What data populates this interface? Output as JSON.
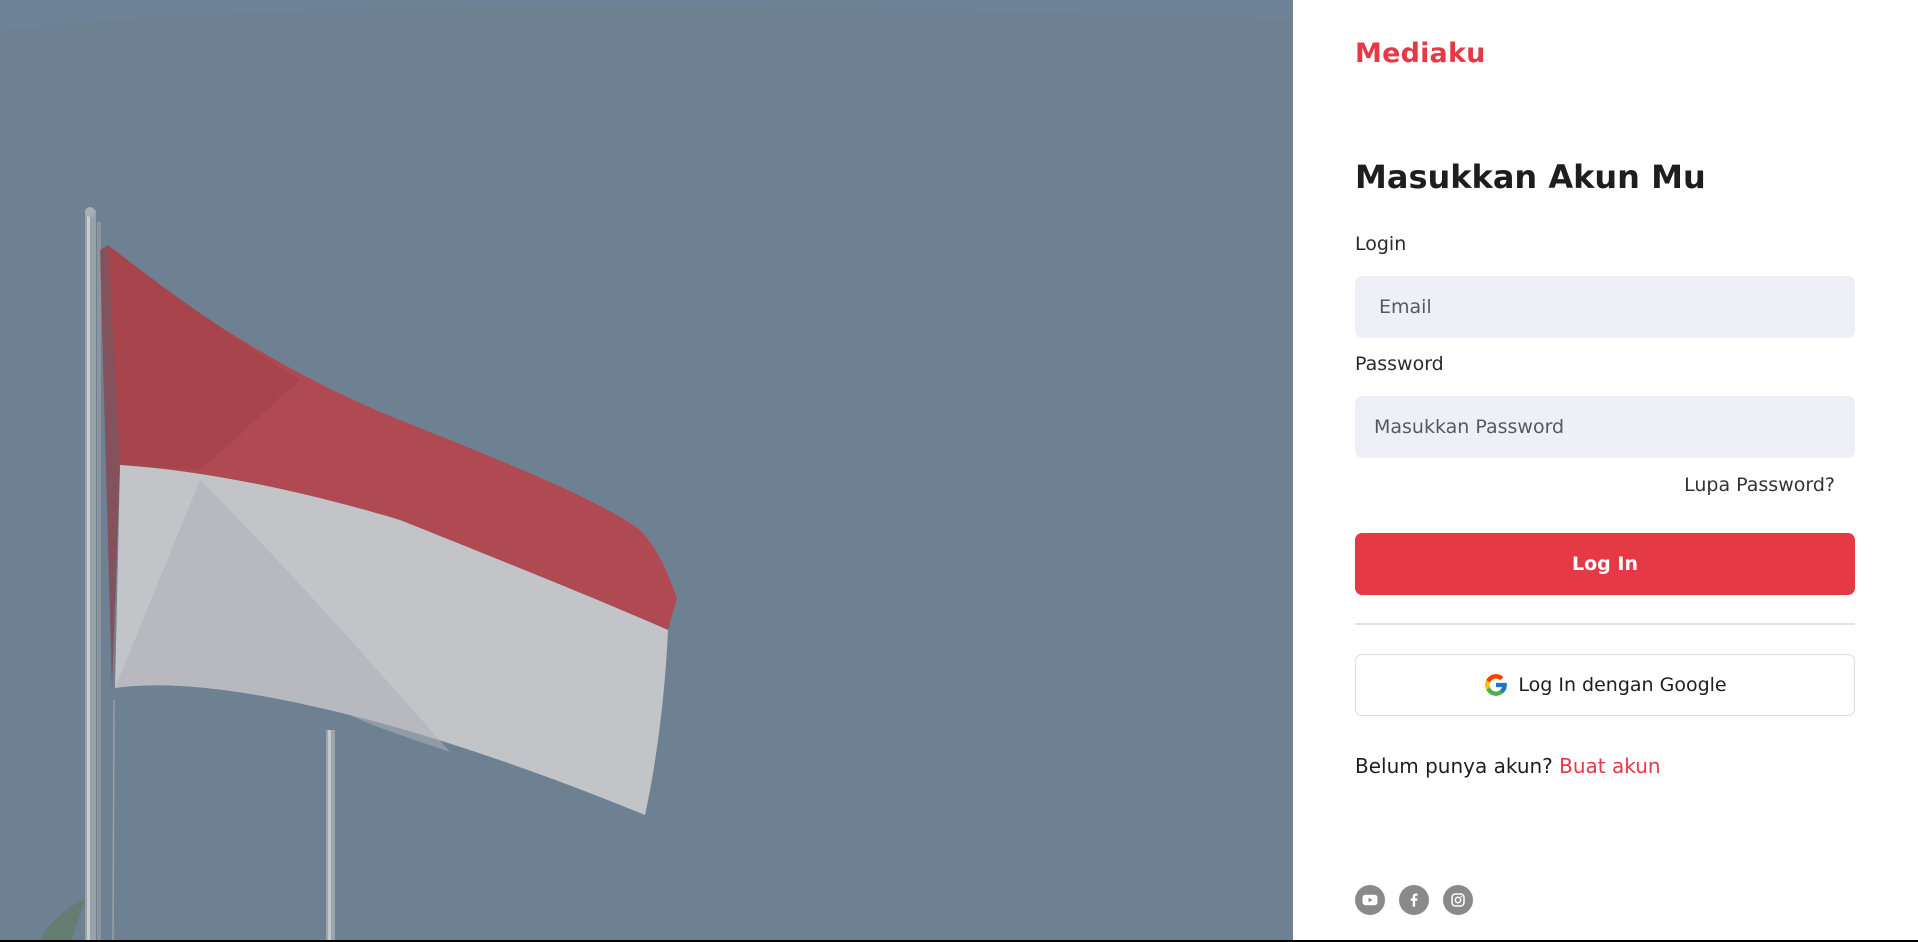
{
  "brand": {
    "name": "Mediaku"
  },
  "hero": {
    "image": "indonesian-flag-on-pole",
    "colors": {
      "sky": "#6d8193",
      "flag_red": "#b04a52",
      "flag_white": "#c2c4c8"
    }
  },
  "login": {
    "heading": "Masukkan Akun Mu",
    "login_label": "Login",
    "email_placeholder": "Email",
    "password_label": "Password",
    "password_placeholder": "Masukkan Password",
    "forgot_password": "Lupa Password?",
    "submit_label": "Log In",
    "google_label": "Log In dengan Google",
    "google_icon": "google-icon"
  },
  "signup": {
    "prompt": "Belum punya akun?",
    "link": "Buat akun"
  },
  "socials": [
    {
      "name": "youtube",
      "icon": "youtube-icon"
    },
    {
      "name": "facebook",
      "icon": "facebook-icon"
    },
    {
      "name": "instagram",
      "icon": "instagram-icon"
    }
  ],
  "colors": {
    "accent": "#e63946",
    "input_bg": "#efeff8",
    "text": "#1e1e1e"
  }
}
